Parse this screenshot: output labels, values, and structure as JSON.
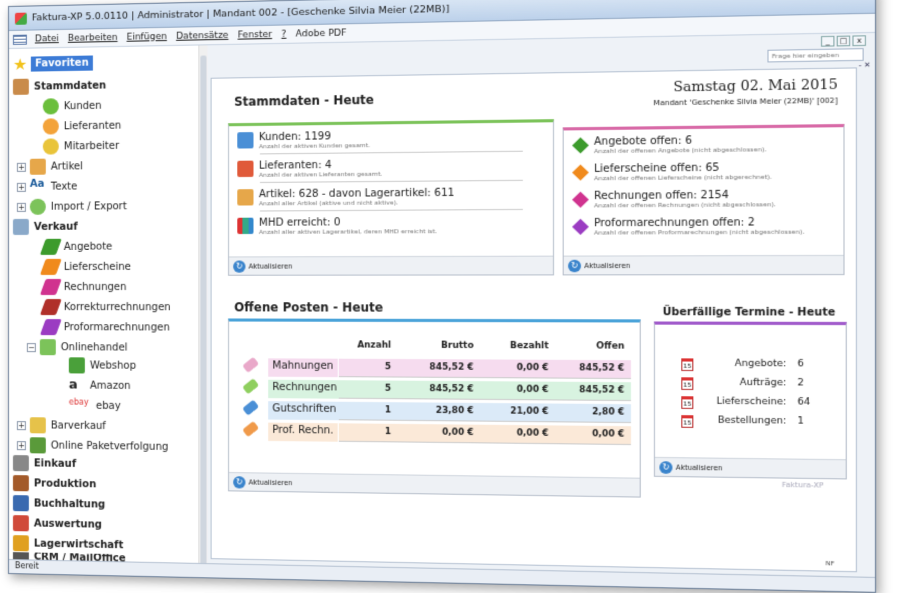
{
  "window": {
    "title": "Faktura-XP 5.0.0110 | Administrator | Mandant 002 - [Geschenke Silvia Meier (22MB)]"
  },
  "menu": [
    "Datei",
    "Bearbeiten",
    "Einfügen",
    "Datensätze",
    "Fenster",
    "?",
    "Adobe PDF"
  ],
  "search": {
    "placeholder": "Frage hier eingeben",
    "close": "- ✕"
  },
  "sidebar": {
    "favorites": "Favoriten",
    "items": [
      {
        "label": "Stammdaten",
        "bold": true
      },
      {
        "label": "Kunden"
      },
      {
        "label": "Lieferanten"
      },
      {
        "label": "Mitarbeiter"
      },
      {
        "label": "Artikel"
      },
      {
        "label": "Texte"
      },
      {
        "label": "Import / Export"
      },
      {
        "label": "Verkauf",
        "bold": true
      },
      {
        "label": "Angebote"
      },
      {
        "label": "Lieferscheine"
      },
      {
        "label": "Rechnungen"
      },
      {
        "label": "Korrekturrechnungen"
      },
      {
        "label": "Proformarechnungen"
      },
      {
        "label": "Onlinehandel"
      },
      {
        "label": "Webshop"
      },
      {
        "label": "Amazon"
      },
      {
        "label": "ebay"
      },
      {
        "label": "Barverkauf"
      },
      {
        "label": "Online Paketverfolgung"
      },
      {
        "label": "Einkauf",
        "bold": true
      },
      {
        "label": "Produktion",
        "bold": true
      },
      {
        "label": "Buchhaltung",
        "bold": true
      },
      {
        "label": "Auswertung",
        "bold": true
      },
      {
        "label": "Lagerwirtschaft",
        "bold": true
      },
      {
        "label": "CRM / MailOffice",
        "bold": true
      }
    ]
  },
  "status": {
    "text": "Bereit",
    "nf": "NF"
  },
  "header": {
    "section1": "Stammdaten - Heute",
    "date": "Samstag 02. Mai 2015",
    "mandant": "Mandant 'Geschenke Silvia Meier (22MB)' [002]"
  },
  "stamm": [
    {
      "title": "Kunden: 1199",
      "sub": "Anzahl der aktiven Kunden gesamt."
    },
    {
      "title": "Lieferanten: 4",
      "sub": "Anzahl der aktiven Lieferanten gesamt."
    },
    {
      "title": "Artikel: 628 - davon Lagerartikel: 611",
      "sub": "Anzahl aller Artikel (aktive und nicht aktive)."
    },
    {
      "title": "MHD erreicht: 0",
      "sub": "Anzahl aller aktiven Lagerartikel, deren MHD erreicht ist."
    }
  ],
  "offen": [
    {
      "title": "Angebote offen: 6",
      "sub": "Anzahl der offenen Angebote (nicht abgeschlossen).",
      "color": "#3c9b2c"
    },
    {
      "title": "Lieferscheine offen: 65",
      "sub": "Anzahl der offenen Lieferscheine (nicht abgerechnet).",
      "color": "#f08a1c"
    },
    {
      "title": "Rechnungen offen: 2154",
      "sub": "Anzahl der offenen Rechnungen (nicht abgeschlossen).",
      "color": "#d0338f"
    },
    {
      "title": "Proformarechnungen offen: 2",
      "sub": "Anzahl der offenen Proformarechnungen (nicht abgeschlossen).",
      "color": "#9b3cc2"
    }
  ],
  "refresh": "Aktualisieren",
  "posten": {
    "title": "Offene Posten - Heute",
    "headers": [
      "Anzahl",
      "Brutto",
      "Bezahlt",
      "Offen"
    ],
    "rows": [
      {
        "label": "Mahnungen",
        "anzahl": "5",
        "brutto": "845,52 €",
        "bezahlt": "0,00 €",
        "offen": "845,52 €",
        "color": "#f6dcef",
        "tag": "#e9a8c9"
      },
      {
        "label": "Rechnungen",
        "anzahl": "5",
        "brutto": "845,52 €",
        "bezahlt": "0,00 €",
        "offen": "845,52 €",
        "color": "#d8f3e0",
        "tag": "#8fcf5f"
      },
      {
        "label": "Gutschriften",
        "anzahl": "1",
        "brutto": "23,80 €",
        "bezahlt": "21,00 €",
        "offen": "2,80 €",
        "color": "#dbeaf8",
        "tag": "#4a8fd6"
      },
      {
        "label": "Prof. Rechn.",
        "anzahl": "1",
        "brutto": "0,00 €",
        "bezahlt": "0,00 €",
        "offen": "0,00 €",
        "color": "#fbe9d8",
        "tag": "#f09a4a"
      }
    ]
  },
  "termine": {
    "title": "Überfällige Termine - Heute",
    "cal": "15",
    "rows": [
      {
        "label": "Angebote:",
        "value": "6"
      },
      {
        "label": "Aufträge:",
        "value": "2"
      },
      {
        "label": "Lieferscheine:",
        "value": "64"
      },
      {
        "label": "Bestellungen:",
        "value": "1"
      }
    ]
  },
  "logo": "Faktura-XP"
}
